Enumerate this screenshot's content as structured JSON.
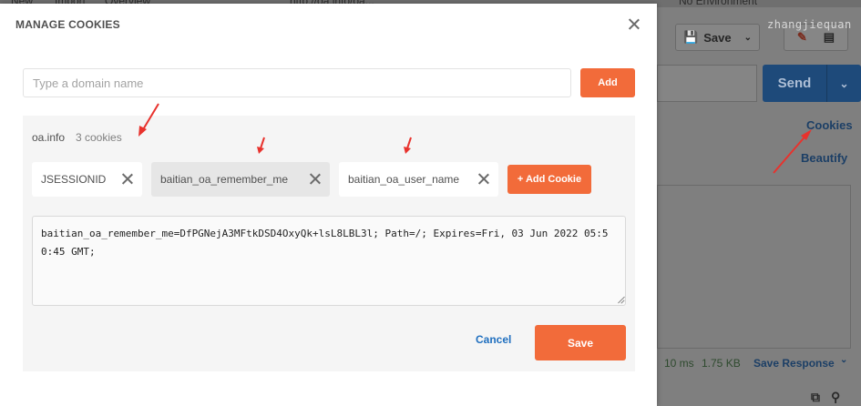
{
  "background": {
    "tabs": [
      "New",
      "Import",
      "Overview",
      "http://oa.info/oa..."
    ],
    "environment": "No Environment",
    "save_label": "Save",
    "send_label": "Send",
    "cookies_link": "Cookies",
    "beautify_link": "Beautify",
    "response_time": "10 ms",
    "response_size": "1.75 KB",
    "save_response": "Save Response",
    "watermark": "zhangjiequan"
  },
  "modal": {
    "title": "MANAGE COOKIES",
    "domain_input": {
      "placeholder": "Type a domain name",
      "value": ""
    },
    "add_label": "Add",
    "domain": {
      "name": "oa.info",
      "count_label": "3 cookies",
      "cookies": [
        "JSESSIONID",
        "baitian_oa_remember_me",
        "baitian_oa_user_name"
      ],
      "selected_cookie": "baitian_oa_remember_me",
      "add_cookie_label": "+ Add Cookie",
      "cookie_value": "baitian_oa_remember_me=DfPGNejA3MFtkDSD4OxyQk+lsL8LBL3l; Path=/; Expires=Fri, 03 Jun 2022 05:50:45 GMT;"
    },
    "cancel_label": "Cancel",
    "save_label": "Save"
  },
  "colors": {
    "accent": "#f26b3a",
    "link": "#1f6fbf",
    "annotation": "#e8322d"
  }
}
